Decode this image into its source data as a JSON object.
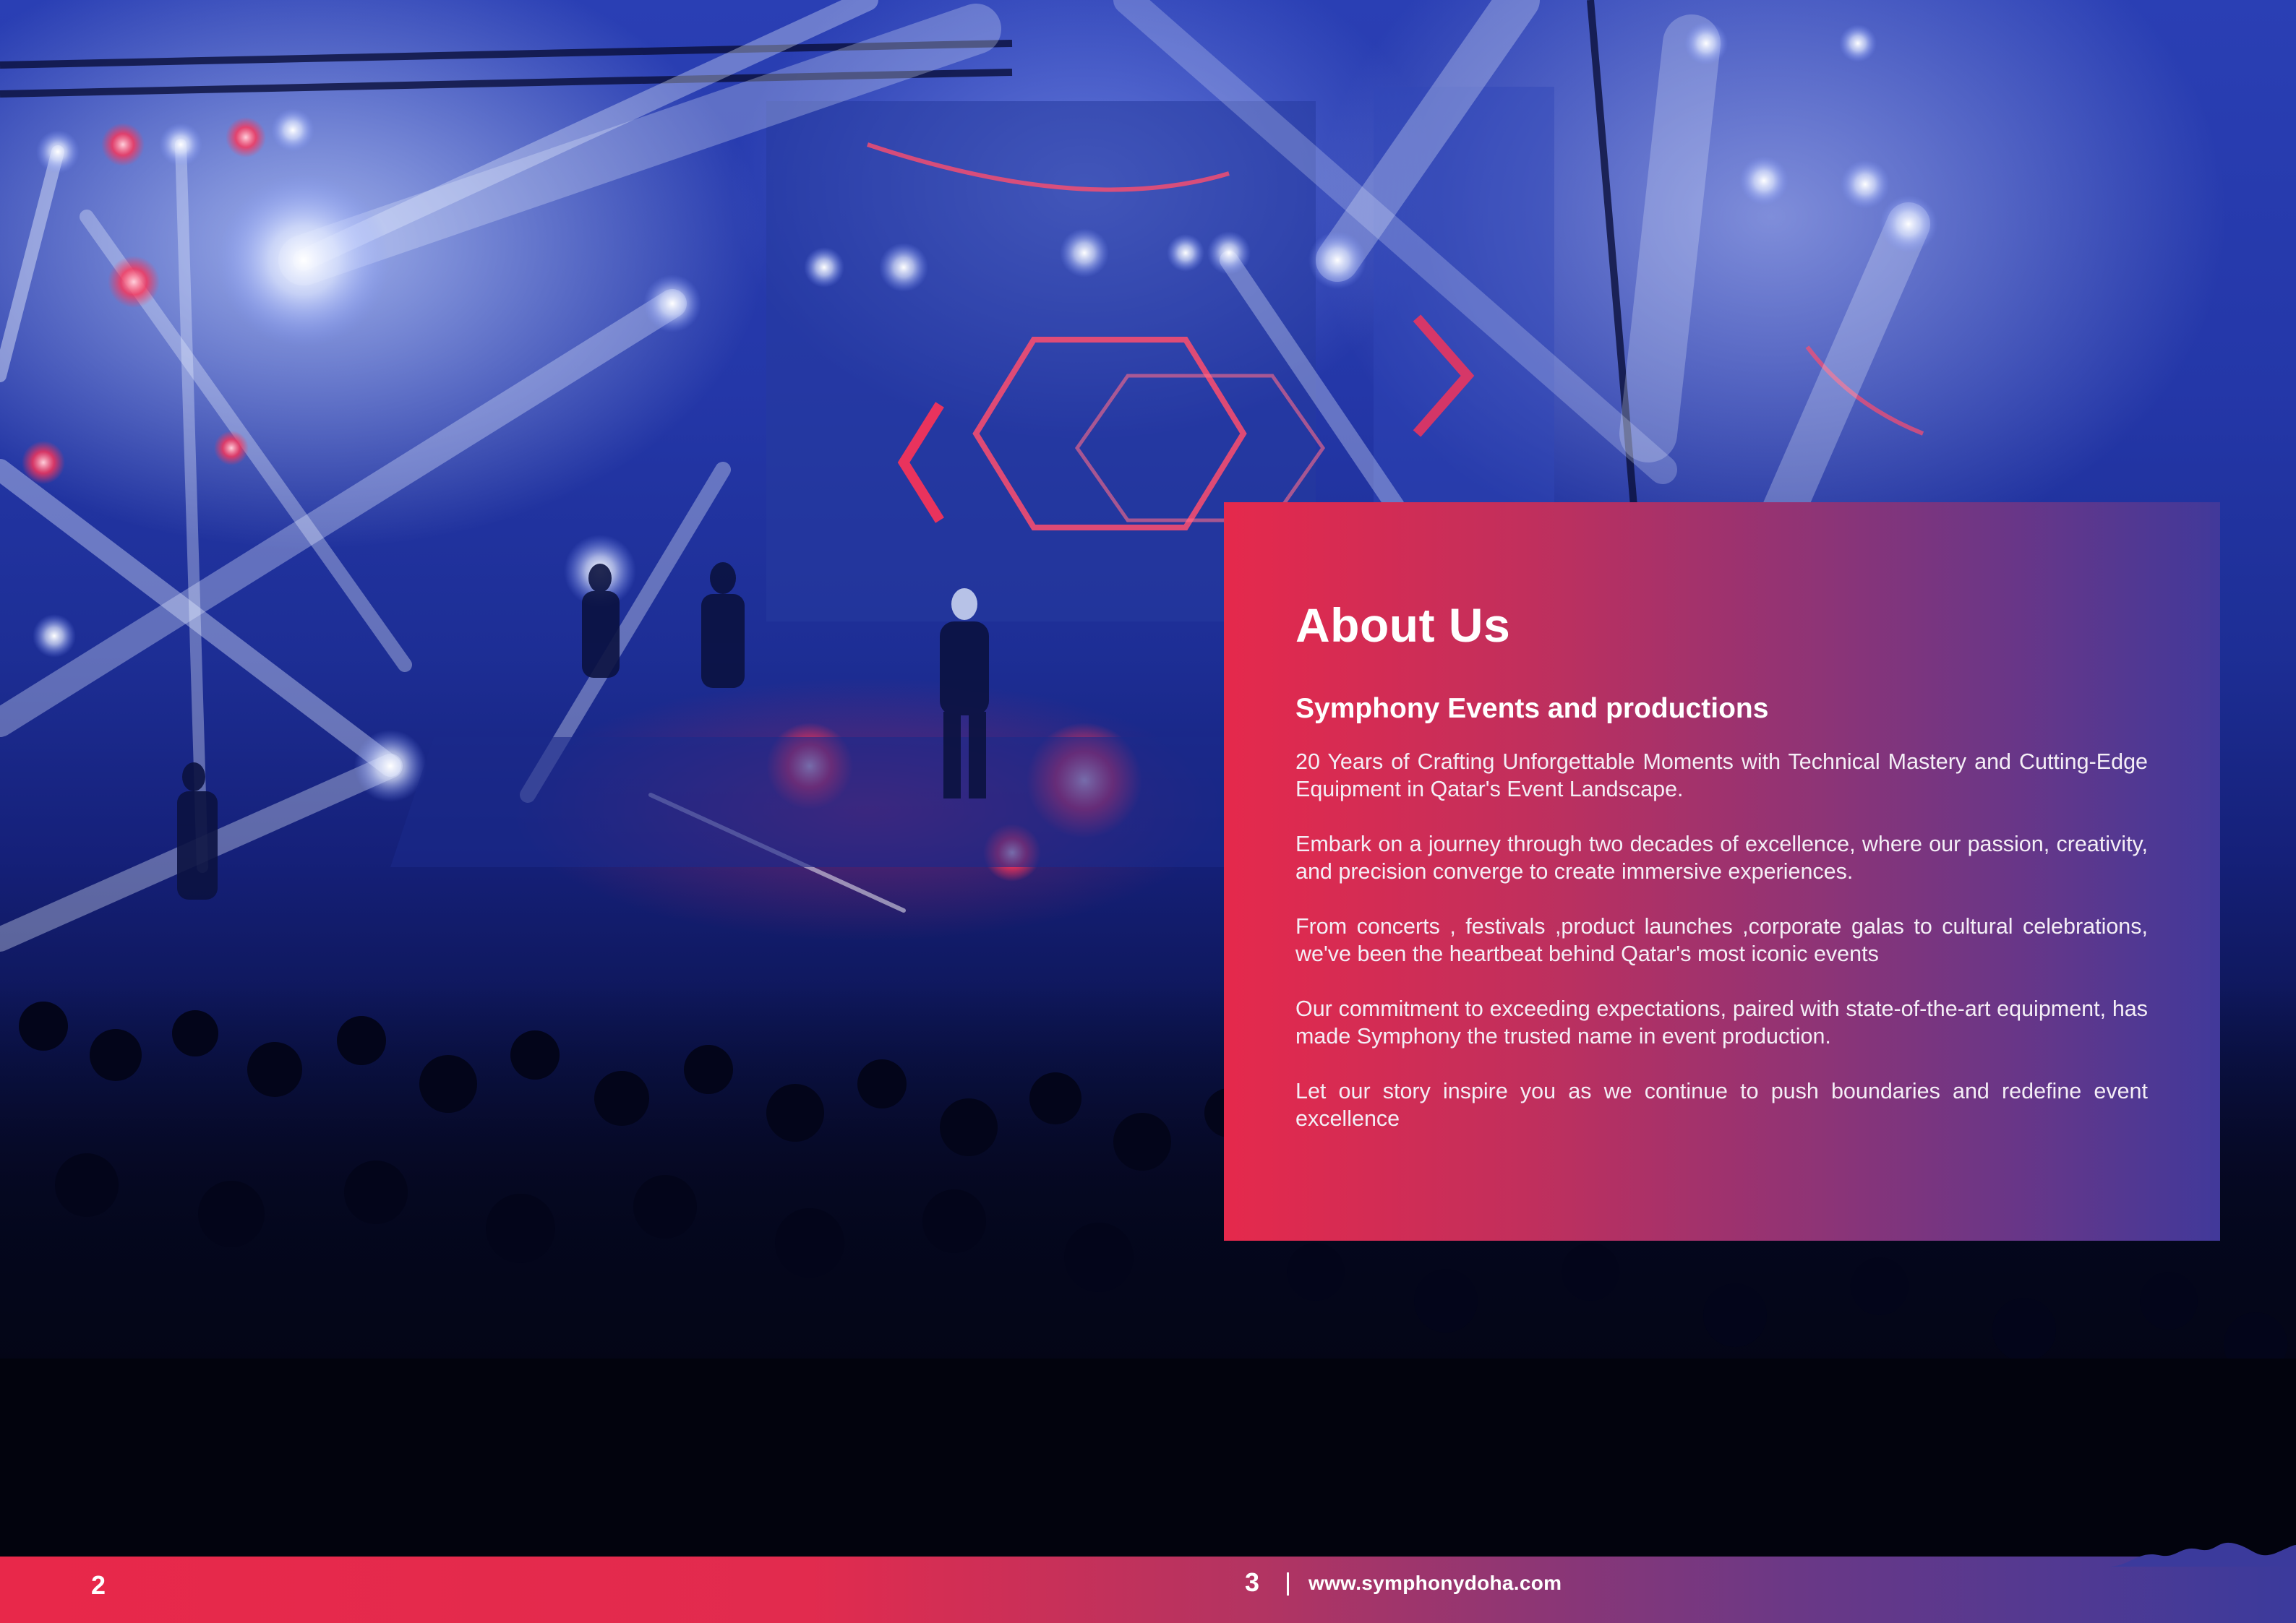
{
  "background_photo": {
    "subject": "concert-stage-with-lights-and-crowd-photo",
    "colors": {
      "stage_blue": "#2a3fb4",
      "dark_crowd": "#04061a",
      "beam_white": "#e8efff",
      "accent_red": "#ff3355"
    }
  },
  "about": {
    "title": "About Us",
    "subtitle": "Symphony Events and productions",
    "paragraphs": [
      "20 Years of Crafting Unforgettable Moments with Technical Mastery and Cutting-Edge Equipment in Qatar's Event Landscape.",
      "Embark on a journey through two decades of excellence, where our passion, creativity, and precision converge to create immersive experiences.",
      "From concerts , festivals ,product launches ,corporate galas to cultural celebrations, we've been the heartbeat behind Qatar's most iconic events",
      "Our commitment to exceeding expectations, paired with state-of-the-art equipment, has made Symphony the trusted name in event production.",
      "Let our story inspire you as we continue to push boundaries and redefine event excellence"
    ],
    "colors": {
      "gradient_start": "#e5294c",
      "gradient_end": "#41399a",
      "text": "#ffffff"
    }
  },
  "footer": {
    "left_page_number": "2",
    "right_page_number": "3",
    "separator": "|",
    "website": "www.symphonydoha.com",
    "colors": {
      "gradient_start": "#e8284a",
      "gradient_end": "#3b3a9c"
    }
  }
}
